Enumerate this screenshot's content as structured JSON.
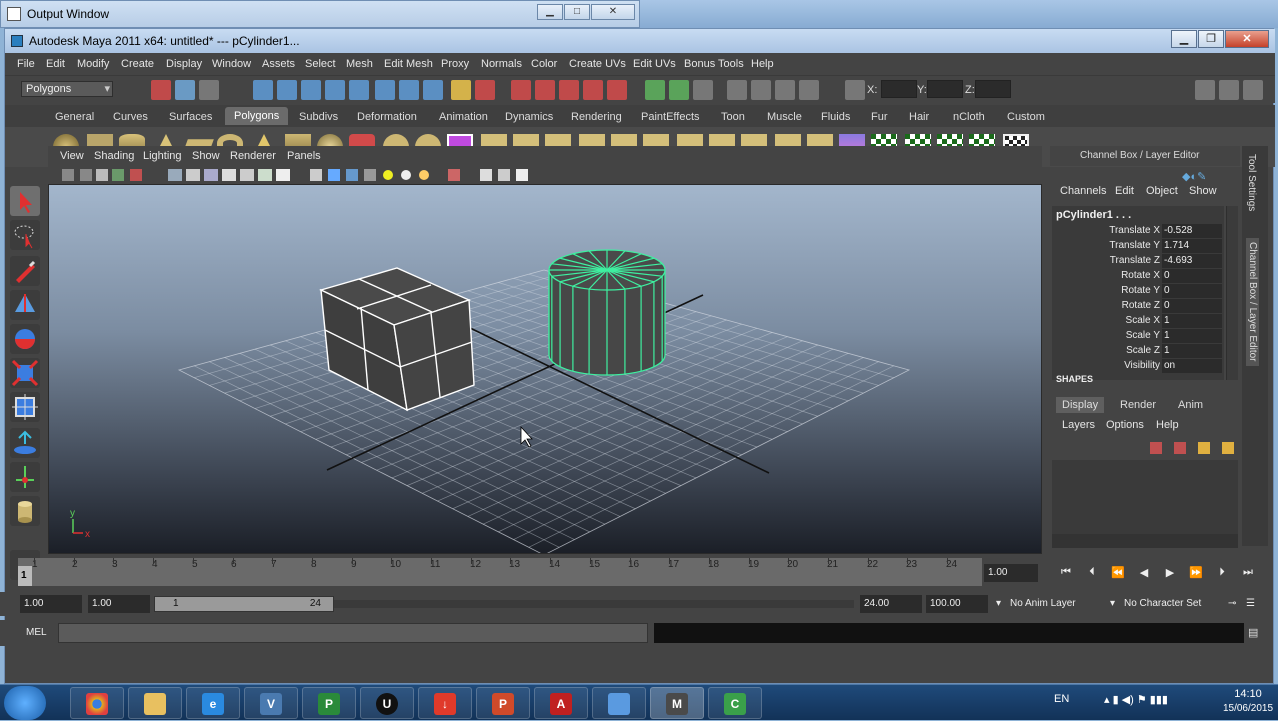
{
  "output_window": {
    "title": "Output Window"
  },
  "maya": {
    "title": "Autodesk Maya 2011 x64: untitled*   ---   pCylinder1...",
    "menu": [
      "File",
      "Edit",
      "Modify",
      "Create",
      "Display",
      "Window",
      "Assets",
      "Select",
      "Mesh",
      "Edit Mesh",
      "Proxy",
      "Normals",
      "Color",
      "Create UVs",
      "Edit UVs",
      "Bonus Tools",
      "Help"
    ],
    "mode": "Polygons",
    "xyz_labels": {
      "x": "X:",
      "y": "Y:",
      "z": "Z:"
    },
    "shelf_tabs": [
      "General",
      "Curves",
      "Surfaces",
      "Polygons",
      "Subdivs",
      "Deformation",
      "Animation",
      "Dynamics",
      "Rendering",
      "PaintEffects",
      "Toon",
      "Muscle",
      "Fluids",
      "Fur",
      "Hair",
      "nCloth",
      "Custom"
    ],
    "active_shelf": "Polygons"
  },
  "viewport": {
    "menu": [
      "View",
      "Shading",
      "Lighting",
      "Show",
      "Renderer",
      "Panels"
    ],
    "axis": {
      "y": "y",
      "x": "x"
    }
  },
  "channel_box": {
    "header": "Channel Box / Layer Editor",
    "menu": [
      "Channels",
      "Edit",
      "Object",
      "Show"
    ],
    "object": "pCylinder1 . . .",
    "attrs": [
      {
        "name": "Translate X",
        "value": "-0.528"
      },
      {
        "name": "Translate Y",
        "value": "1.714"
      },
      {
        "name": "Translate Z",
        "value": "-4.693"
      },
      {
        "name": "Rotate X",
        "value": "0"
      },
      {
        "name": "Rotate Y",
        "value": "0"
      },
      {
        "name": "Rotate Z",
        "value": "0"
      },
      {
        "name": "Scale X",
        "value": "1"
      },
      {
        "name": "Scale Y",
        "value": "1"
      },
      {
        "name": "Scale Z",
        "value": "1"
      },
      {
        "name": "Visibility",
        "value": "on"
      }
    ],
    "shapes_label": "SHAPES",
    "side_tabs": [
      "Tool Settings",
      "Channel Box / Layer Editor"
    ]
  },
  "layer_editor": {
    "tabs": [
      "Display",
      "Render",
      "Anim"
    ],
    "active_tab": "Display",
    "menu": [
      "Layers",
      "Options",
      "Help"
    ]
  },
  "timeline": {
    "ticks": [
      "1",
      "2",
      "3",
      "4",
      "5",
      "6",
      "7",
      "8",
      "9",
      "10",
      "11",
      "12",
      "13",
      "14",
      "15",
      "16",
      "17",
      "18",
      "19",
      "20",
      "21",
      "22",
      "23",
      "24"
    ],
    "current_frame": "1",
    "current_time": "1.00"
  },
  "range": {
    "start_time": "1.00",
    "playback_start": "1.00",
    "slider_start": "1",
    "slider_end": "24",
    "playback_end": "24.00",
    "end_time": "100.00",
    "anim_layer": "No Anim Layer",
    "character_set": "No Character Set"
  },
  "command_line": {
    "label": "MEL"
  },
  "taskbar": {
    "apps": [
      "chrome",
      "explorer",
      "ie",
      "vb",
      "project",
      "unreal",
      "download",
      "powerpoint",
      "acrobat",
      "control-panel",
      "maya",
      "camtasia"
    ],
    "language": "EN",
    "time": "14:10",
    "date": "15/06/2015"
  },
  "colors": {
    "accent": "#6fdfb0",
    "select": "#3ef0a0"
  }
}
